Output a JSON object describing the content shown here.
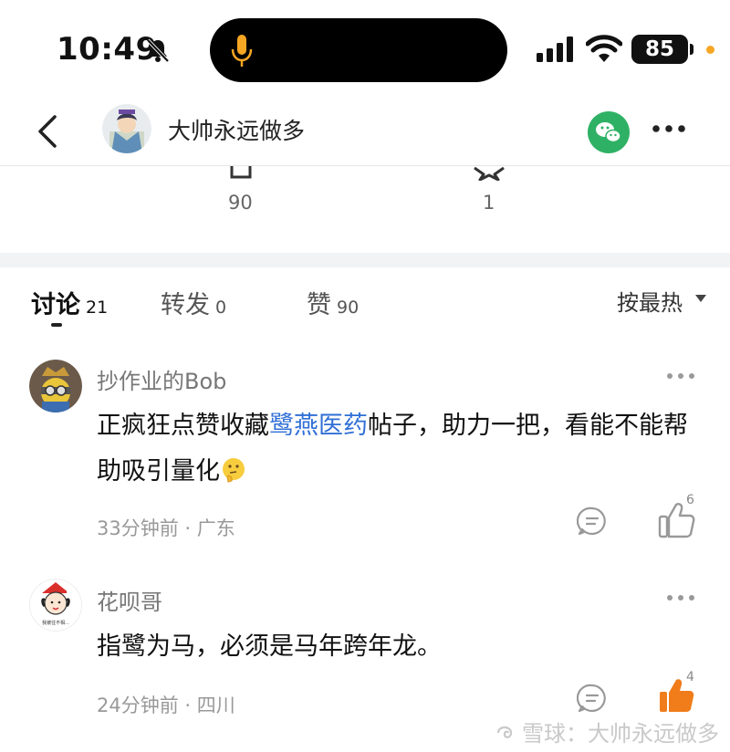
{
  "status_bar": {
    "time": "10:49",
    "battery": "85",
    "icons": [
      "bell-muted-icon",
      "mic-icon",
      "signal-icon",
      "wifi-icon",
      "battery-icon"
    ]
  },
  "nav": {
    "title": "大帅永远做多",
    "icons": [
      "back-icon",
      "avatar",
      "wechat-icon",
      "more-icon"
    ],
    "wechat_color": "#2fb165"
  },
  "actions": {
    "likes_count": "90",
    "favorites_count": "1"
  },
  "tabs": [
    {
      "label": "讨论",
      "count": "21",
      "active": true
    },
    {
      "label": "转发",
      "count": "0",
      "active": false
    },
    {
      "label": "赞",
      "count": "90",
      "active": false
    }
  ],
  "sort": {
    "label": "按最热"
  },
  "comments": [
    {
      "user": "抄作业的Bob",
      "text_before": "正疯狂点赞收藏",
      "link": "鹭燕医药",
      "text_after": "帖子，助力一把，看能不能帮助吸引量化",
      "emoji": "thinking-emoji",
      "time": "33分钟前",
      "location": "广东",
      "likes": "6",
      "liked": false
    },
    {
      "user": "花呗哥",
      "text": "指鹭为马，必须是马年跨年龙。",
      "time": "24分钟前",
      "location": "四川",
      "likes": "4",
      "liked": true,
      "avatar_caption": "我被往不相..."
    }
  ],
  "meta_separator": " · ",
  "watermark": "雪球：大帅永远做多",
  "colors": {
    "link": "#2f6fd6",
    "liked": "#f07c1a",
    "watermark": "#c9c9c9"
  }
}
